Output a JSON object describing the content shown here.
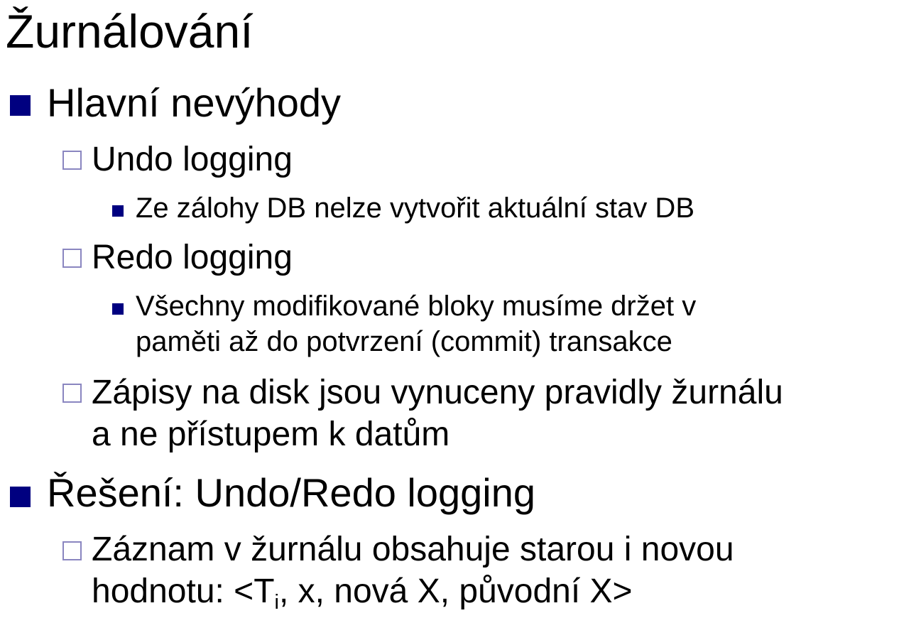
{
  "slide": {
    "title": "Žurnálování",
    "colors": {
      "bullet_primary": "#000080",
      "bullet_secondary_border": "#8a86c0",
      "text": "#000000",
      "background": "#ffffff"
    },
    "sections": [
      {
        "heading": "Hlavní nevýhody",
        "items": [
          {
            "text": "Undo logging",
            "subitems": [
              "Ze zálohy DB nelze vytvořit aktuální stav DB"
            ]
          },
          {
            "text": "Redo logging",
            "subitems": [
              {
                "line1": "Všechny modifikované bloky musíme držet v",
                "line2": "paměti až do potvrzení (commit) transakce"
              }
            ]
          },
          {
            "line1": "Zápisy na disk jsou vynuceny pravidly žurnálu",
            "line2": "a ne přístupem k datům"
          }
        ]
      },
      {
        "heading": "Řešení: Undo/Redo logging",
        "items": [
          {
            "line1": "Záznam v žurnálu obsahuje starou i novou",
            "line2_prefix": "hodnotu: <T",
            "line2_subscript": "i",
            "line2_suffix": ", x, nová X, původní X>"
          }
        ]
      }
    ]
  }
}
